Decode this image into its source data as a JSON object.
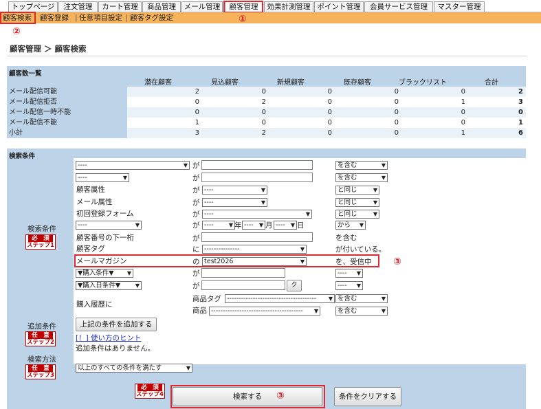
{
  "tabs": [
    {
      "label": "トップページ"
    },
    {
      "label": "注文管理"
    },
    {
      "label": "カート管理"
    },
    {
      "label": "商品管理"
    },
    {
      "label": "メール管理"
    },
    {
      "label": "顧客管理"
    },
    {
      "label": "効果計測管理"
    },
    {
      "label": "ポイント管理"
    },
    {
      "label": "会員サービス管理"
    },
    {
      "label": "マスター管理"
    }
  ],
  "subnav": {
    "items": [
      "顧客検索",
      "顧客登録",
      "任意項目設定",
      "顧客タグ設定"
    ],
    "separator": "|"
  },
  "annotations": {
    "m1": "①",
    "m2": "②",
    "m3a": "③",
    "m3b": "③"
  },
  "page_title": "顧客管理 ＞ 顧客検索",
  "summary": {
    "caption": "顧客数一覧",
    "headers": [
      "潜在顧客",
      "見込顧客",
      "新規顧客",
      "既存顧客",
      "ブラックリスト",
      "合計"
    ],
    "rows": [
      {
        "label": "メール配信可能",
        "values": [
          "2",
          "0",
          "0",
          "0",
          "0",
          "2"
        ]
      },
      {
        "label": "メール配信拒否",
        "values": [
          "0",
          "2",
          "0",
          "0",
          "1",
          "3"
        ]
      },
      {
        "label": "メール配信一時不能",
        "values": [
          "0",
          "0",
          "0",
          "0",
          "0",
          "0"
        ]
      },
      {
        "label": "メール配信不能",
        "values": [
          "1",
          "0",
          "0",
          "0",
          "0",
          "1"
        ]
      },
      {
        "label": "小計",
        "values": [
          "3",
          "2",
          "0",
          "0",
          "1",
          "6"
        ]
      }
    ]
  },
  "search": {
    "caption": "検索条件",
    "side_labels": {
      "conditions": "検索条件",
      "additional": "追加条件",
      "method": "検索方法"
    },
    "steps": {
      "s1": {
        "top": "必　須",
        "bottom": "ステップ1"
      },
      "s2": {
        "top": "任　意",
        "bottom": "ステップ2"
      },
      "s3": {
        "top": "任　意",
        "bottom": "ステップ3"
      },
      "s4": {
        "top": "必　須",
        "bottom": "ステップ4"
      }
    },
    "particles": {
      "ga": "が",
      "ni": "に",
      "no": "の",
      "year": "年",
      "month": "月",
      "day": "日"
    },
    "placeholder_select": "----",
    "rows": {
      "zokusei": "顧客属性",
      "mail_zokusei": "メール属性",
      "first_form": "初回登録フォーム",
      "number_last": "顧客番号の下一桁",
      "tag": "顧客タグ",
      "magazine": "メールマガジン",
      "purchase_cond": "▼購入条件▼",
      "purchase_date": "▼購入日条件▼",
      "history": "購入履歴に",
      "product_tag": "商品タグ",
      "product": "商品"
    },
    "values": {
      "tag_select": "---------------",
      "magazine_select": "test2026",
      "product_tag_select": "--------------------------------------",
      "product_select": "---------------------------------------"
    },
    "ops": {
      "contains": "を含む",
      "same": "と同じ",
      "from": "から",
      "contains_plain": "を含む",
      "tagged": "が付いている。",
      "receiving": "を、受信中"
    },
    "calendar_btn": "ク",
    "add_button": "上記の条件を追加する",
    "hint_link": "[！] 使い方のヒント",
    "no_additional": "追加条件はありません。",
    "method_select": "以上のすべての条件を満たす",
    "search_button": "検索する",
    "clear_button": "条件をクリアする"
  }
}
